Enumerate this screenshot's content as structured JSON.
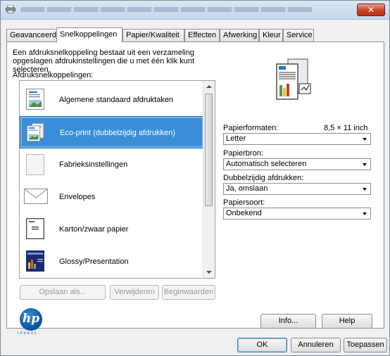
{
  "window": {
    "close_label": "✕"
  },
  "tabs": [
    {
      "label": "Geavanceerd"
    },
    {
      "label": "Snelkoppelingen"
    },
    {
      "label": "Papier/Kwaliteit"
    },
    {
      "label": "Effecten"
    },
    {
      "label": "Afwerking"
    },
    {
      "label": "Kleur"
    },
    {
      "label": "Service"
    }
  ],
  "description": "Een afdruksnelkoppeling bestaat uit een verzameling opgeslagen afdrukinstellingen die u met één klik kunt selecteren.",
  "shortcuts_label": "Afdruksnelkoppelingen:",
  "shortcuts": [
    {
      "label": "Algemene standaard afdruktaken",
      "icon": "document-image-icon"
    },
    {
      "label": "Eco-print (dubbelzijdig afdrukken)",
      "icon": "duplex-document-icon"
    },
    {
      "label": "Fabrieksinstellingen",
      "icon": "blank-page-icon"
    },
    {
      "label": "Envelopes",
      "icon": "envelope-icon"
    },
    {
      "label": "Karton/zwaar papier",
      "icon": "cardstock-icon"
    },
    {
      "label": "Glossy/Presentation",
      "icon": "presentation-icon"
    }
  ],
  "list_buttons": {
    "save": "Opslaan als...",
    "delete": "Verwijderen",
    "defaults": "Beginwaarden"
  },
  "settings": {
    "paper_size_label": "Papierformaten:",
    "paper_size_dims": "8,5 × 11 inch",
    "paper_size_value": "Letter",
    "source_label": "Papierbron:",
    "source_value": "Automatisch selecteren",
    "duplex_label": "Dubbelzijdig afdrukken:",
    "duplex_value": "Ja, omslaan",
    "type_label": "Papiersoort:",
    "type_value": "Onbekend"
  },
  "brand": {
    "logo_text": "hp",
    "tagline": "invent"
  },
  "bottom_buttons": {
    "info": "Info...",
    "help": "Help",
    "ok": "OK",
    "cancel": "Annuleren",
    "apply": "Toepassen"
  },
  "colors": {
    "selection": "#3a8ed8",
    "hp_blue": "#0b5aa6",
    "close_red": "#c7432a"
  }
}
